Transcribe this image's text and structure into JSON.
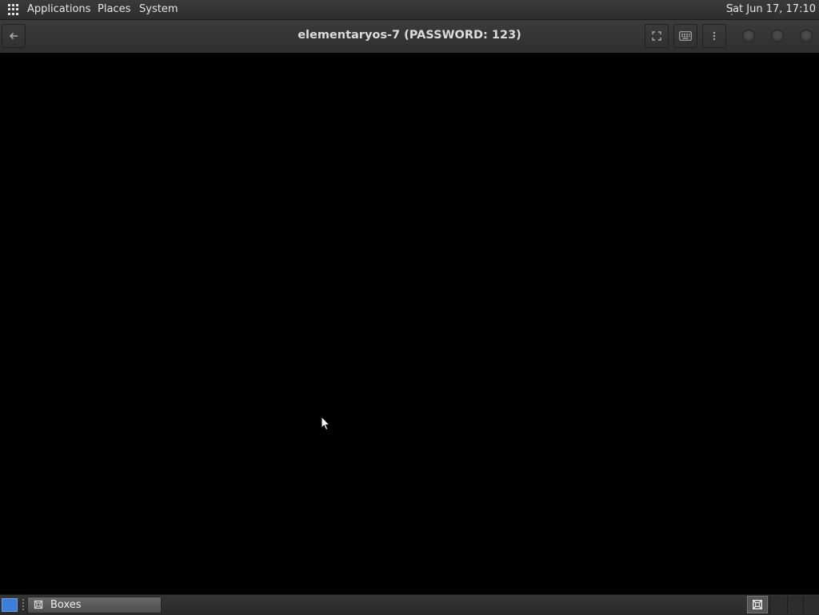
{
  "top_panel": {
    "apps_icon": "grid-icon",
    "menus": [
      "Applications",
      "Places",
      "System"
    ],
    "clock": "Sat Jun 17, 17:10"
  },
  "header_bar": {
    "title": "elementaryos-7 (PASSWORD: 123)",
    "back_icon": "arrow-left-icon",
    "fullscreen_icon": "fullscreen-icon",
    "keyboard_icon": "keyboard-icon",
    "menu_icon": "kebab-menu-icon"
  },
  "taskbar": {
    "show_desktop_icon": "desktop-icon",
    "tasks": [
      {
        "label": "Boxes",
        "icon": "boxes-app-icon"
      }
    ],
    "workspaces": 4
  },
  "colors": {
    "panel_bg": "#2e2e2e",
    "show_desktop_accent": "#3d7ed8",
    "vm_bg": "#000000"
  }
}
